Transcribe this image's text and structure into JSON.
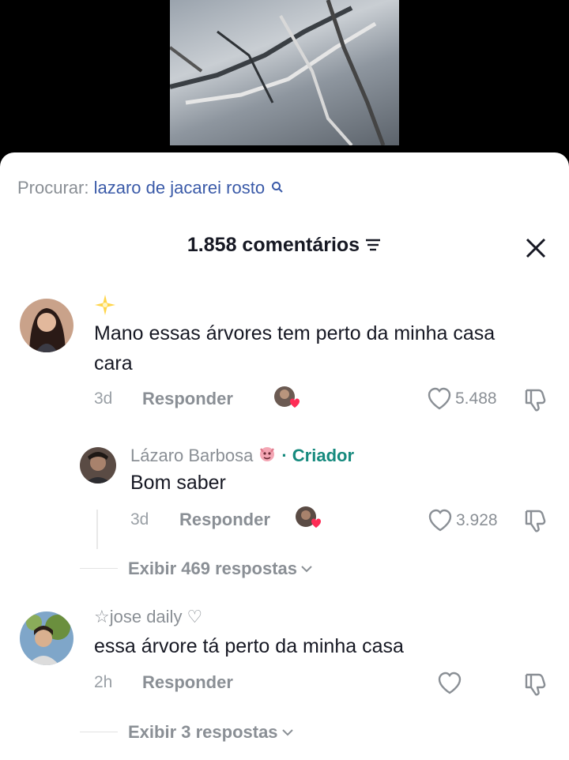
{
  "search": {
    "prefix": "Procurar:",
    "query": "lazaro de jacarei rosto"
  },
  "header": {
    "title": "1.858 comentários"
  },
  "comments": [
    {
      "username": "",
      "text": "Mano essas árvores tem perto da minha casa cara",
      "time": "3d",
      "reply_label": "Responder",
      "likes": "5.488",
      "view_replies": "Exibir 469 respostas",
      "reply": {
        "username": "Lázaro Barbosa",
        "creator_tag": "· Criador",
        "text": "Bom saber",
        "time": "3d",
        "reply_label": "Responder",
        "likes": "3.928"
      }
    },
    {
      "username": "☆jose daily ♡",
      "text": "essa árvore tá perto da minha casa",
      "time": "2h",
      "reply_label": "Responder",
      "likes": "",
      "view_replies": "Exibir 3 respostas"
    }
  ],
  "colors": {
    "creator": "#168a7e",
    "search_query": "#3a5aa8",
    "like_badge": "#fe2c55"
  }
}
